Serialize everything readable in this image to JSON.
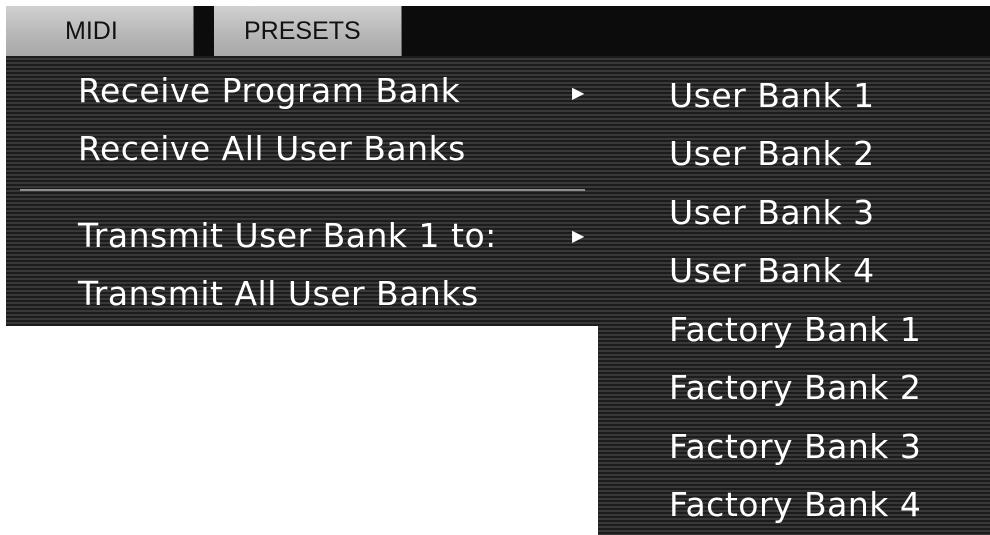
{
  "menubar": {
    "tabs": [
      {
        "label": "MIDI"
      },
      {
        "label": "PRESETS"
      }
    ]
  },
  "main_menu": {
    "items": [
      {
        "label": "Receive Program Bank",
        "has_submenu": true
      },
      {
        "label": "Receive All User Banks",
        "has_submenu": false
      },
      {
        "label": "Transmit User Bank 1 to:",
        "has_submenu": true
      },
      {
        "label": "Transmit All User Banks",
        "has_submenu": false
      }
    ],
    "arrow_glyph": "▶"
  },
  "submenu": {
    "items": [
      {
        "label": "User Bank 1"
      },
      {
        "label": "User Bank 2"
      },
      {
        "label": "User Bank 3"
      },
      {
        "label": "User Bank 4"
      },
      {
        "label": "Factory Bank 1"
      },
      {
        "label": "Factory Bank 2"
      },
      {
        "label": "Factory Bank 3"
      },
      {
        "label": "Factory Bank 4"
      }
    ]
  },
  "colors": {
    "menu_text": "#ffffff",
    "menubar_bg": "#0c0c0c",
    "tab_bg": "#c0c0c0",
    "separator": "#8f8f8f"
  }
}
